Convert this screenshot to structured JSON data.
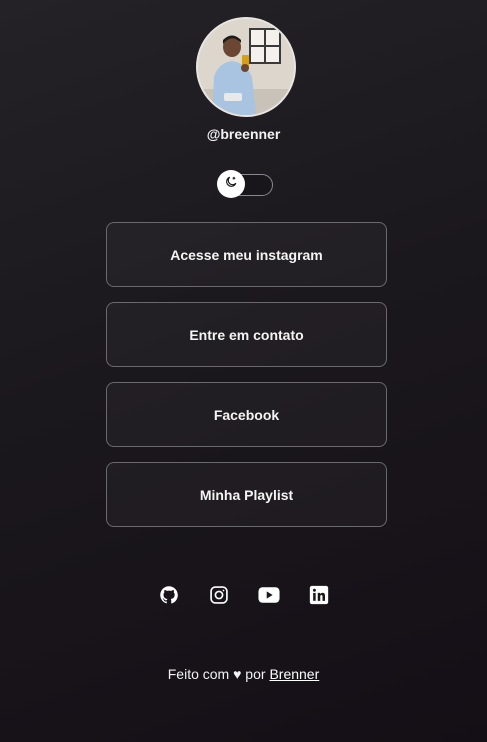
{
  "profile": {
    "username": "@breenner"
  },
  "theme_toggle": {
    "icon": "moon-icon"
  },
  "links": [
    {
      "label": "Acesse meu instagram"
    },
    {
      "label": "Entre em contato"
    },
    {
      "label": "Facebook"
    },
    {
      "label": "Minha Playlist"
    }
  ],
  "socials": [
    {
      "icon": "github-icon"
    },
    {
      "icon": "instagram-icon"
    },
    {
      "icon": "youtube-icon"
    },
    {
      "icon": "linkedin-icon"
    }
  ],
  "footer": {
    "prefix": "Feito com ♥ por",
    "author": "Brenner"
  }
}
